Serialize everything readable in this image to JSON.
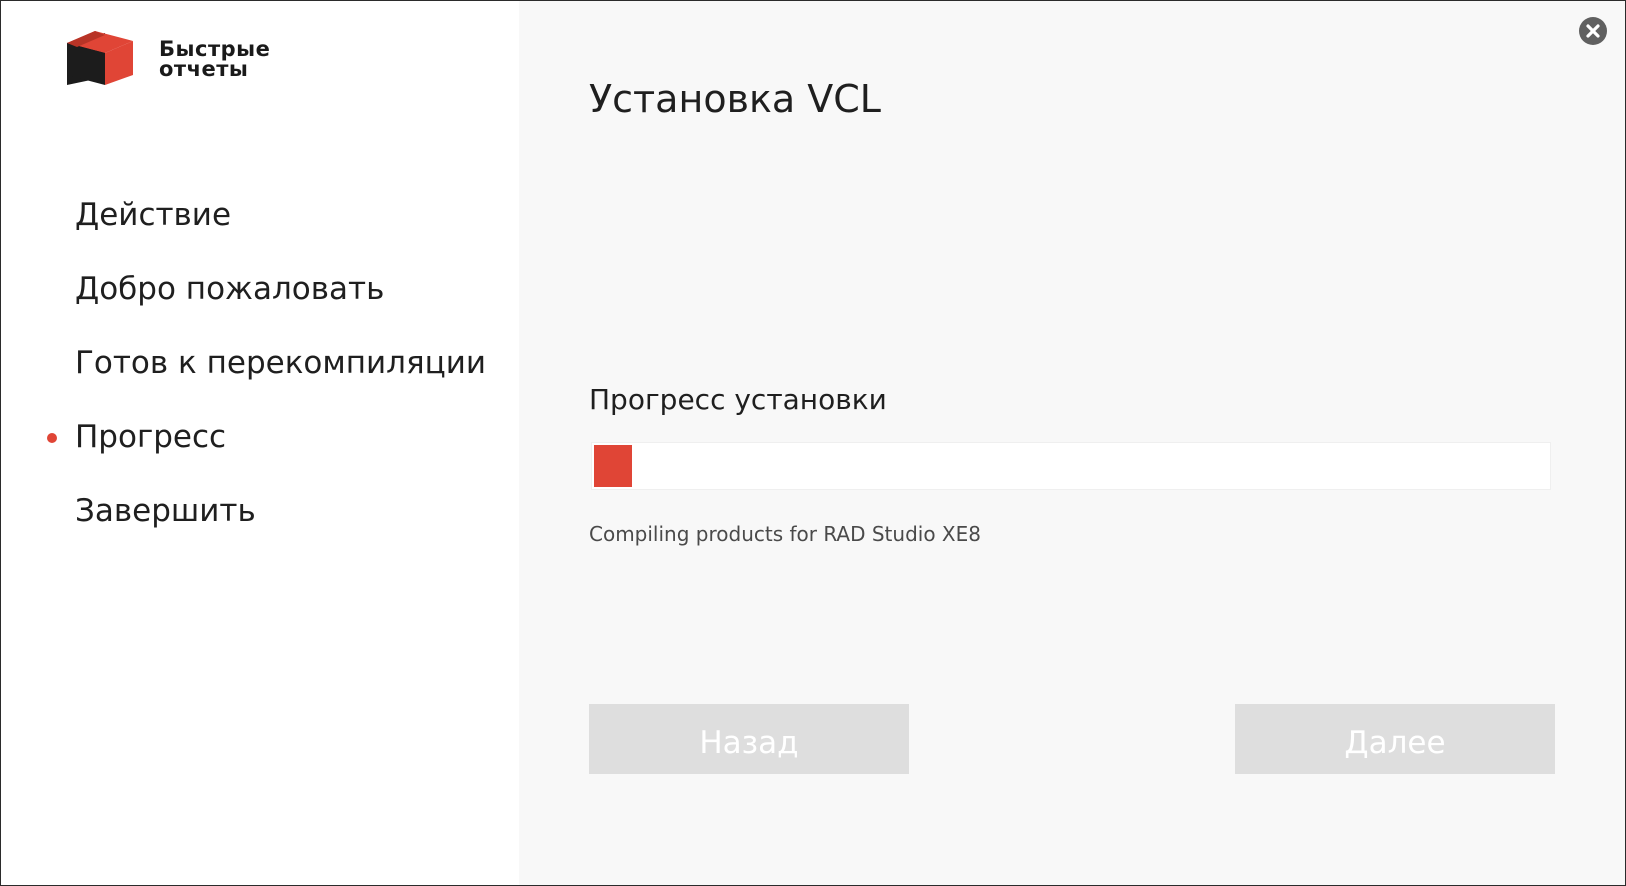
{
  "window": {
    "brand_line1": "Быстрые",
    "brand_line2": "отчеты",
    "title": "Установка VCL"
  },
  "sidebar": {
    "steps": [
      {
        "label": "Действие",
        "active": false
      },
      {
        "label": "Добро пожаловать",
        "active": false
      },
      {
        "label": "Готов к перекомпиляции",
        "active": false
      },
      {
        "label": "Прогресс",
        "active": true
      },
      {
        "label": "Завершить",
        "active": false
      }
    ]
  },
  "main": {
    "progress_label": "Прогресс установки",
    "progress_fraction": 0.04,
    "status_text": "Compiling products for RAD Studio XE8"
  },
  "buttons": {
    "back_label": "Назад",
    "next_label": "Далее",
    "back_enabled": false,
    "next_enabled": false
  },
  "colors": {
    "accent": "#e04536",
    "logo_dark": "#1c1c1c",
    "button_disabled_bg": "#dedede",
    "content_bg": "#f8f8f8"
  },
  "icons": {
    "logo": "brand-cube-icon",
    "close": "close-icon",
    "active_step": "active-dot-icon"
  }
}
